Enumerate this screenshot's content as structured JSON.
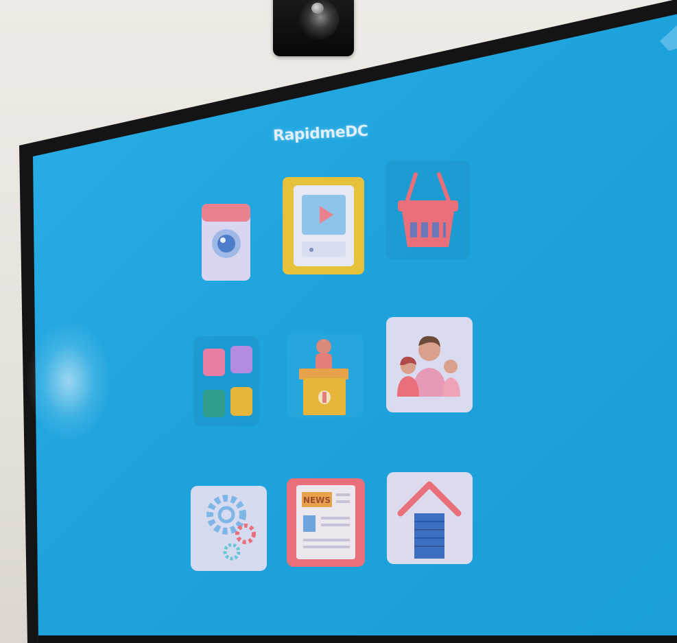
{
  "screen": {
    "app_title": "RapidmeDC",
    "background_color": "#1fa3dc"
  },
  "tiles": [
    {
      "icon": "camera-app-icon",
      "label": ""
    },
    {
      "icon": "video-tablet-icon",
      "label": ""
    },
    {
      "icon": "shopping-basket-icon",
      "label": ""
    },
    {
      "icon": "apps-grid-icon",
      "label": ""
    },
    {
      "icon": "presenter-podium-icon",
      "label": ""
    },
    {
      "icon": "people-icon",
      "label": ""
    },
    {
      "icon": "gears-icon",
      "label": ""
    },
    {
      "icon": "news-icon",
      "label": ""
    },
    {
      "icon": "home-icon",
      "label": ""
    }
  ]
}
